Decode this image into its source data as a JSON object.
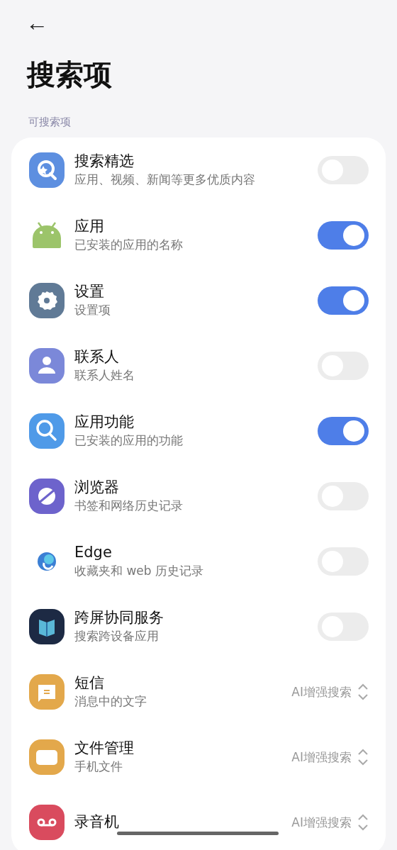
{
  "header": {
    "back": "←",
    "title": "搜索项"
  },
  "section_label": "可搜索项",
  "items": [
    {
      "kind": "toggle",
      "title": "搜索精选",
      "subtitle": "应用、视频、新闻等更多优质内容",
      "on": false
    },
    {
      "kind": "toggle",
      "title": "应用",
      "subtitle": "已安装的应用的名称",
      "on": true
    },
    {
      "kind": "toggle",
      "title": "设置",
      "subtitle": "设置项",
      "on": true
    },
    {
      "kind": "toggle",
      "title": "联系人",
      "subtitle": "联系人姓名",
      "on": false
    },
    {
      "kind": "toggle",
      "title": "应用功能",
      "subtitle": "已安装的应用的功能",
      "on": true
    },
    {
      "kind": "toggle",
      "title": "浏览器",
      "subtitle": "书签和网络历史记录",
      "on": false
    },
    {
      "kind": "toggle",
      "title": "Edge",
      "subtitle": "收藏夹和 web 历史记录",
      "on": false
    },
    {
      "kind": "toggle",
      "title": "跨屏协同服务",
      "subtitle": "搜索跨设备应用",
      "on": false
    },
    {
      "kind": "select",
      "title": "短信",
      "subtitle": "消息中的文字",
      "value": "AI增强搜索"
    },
    {
      "kind": "select",
      "title": "文件管理",
      "subtitle": "手机文件",
      "value": "AI增强搜索"
    },
    {
      "kind": "select",
      "title": "录音机",
      "value": "AI增强搜索"
    }
  ]
}
